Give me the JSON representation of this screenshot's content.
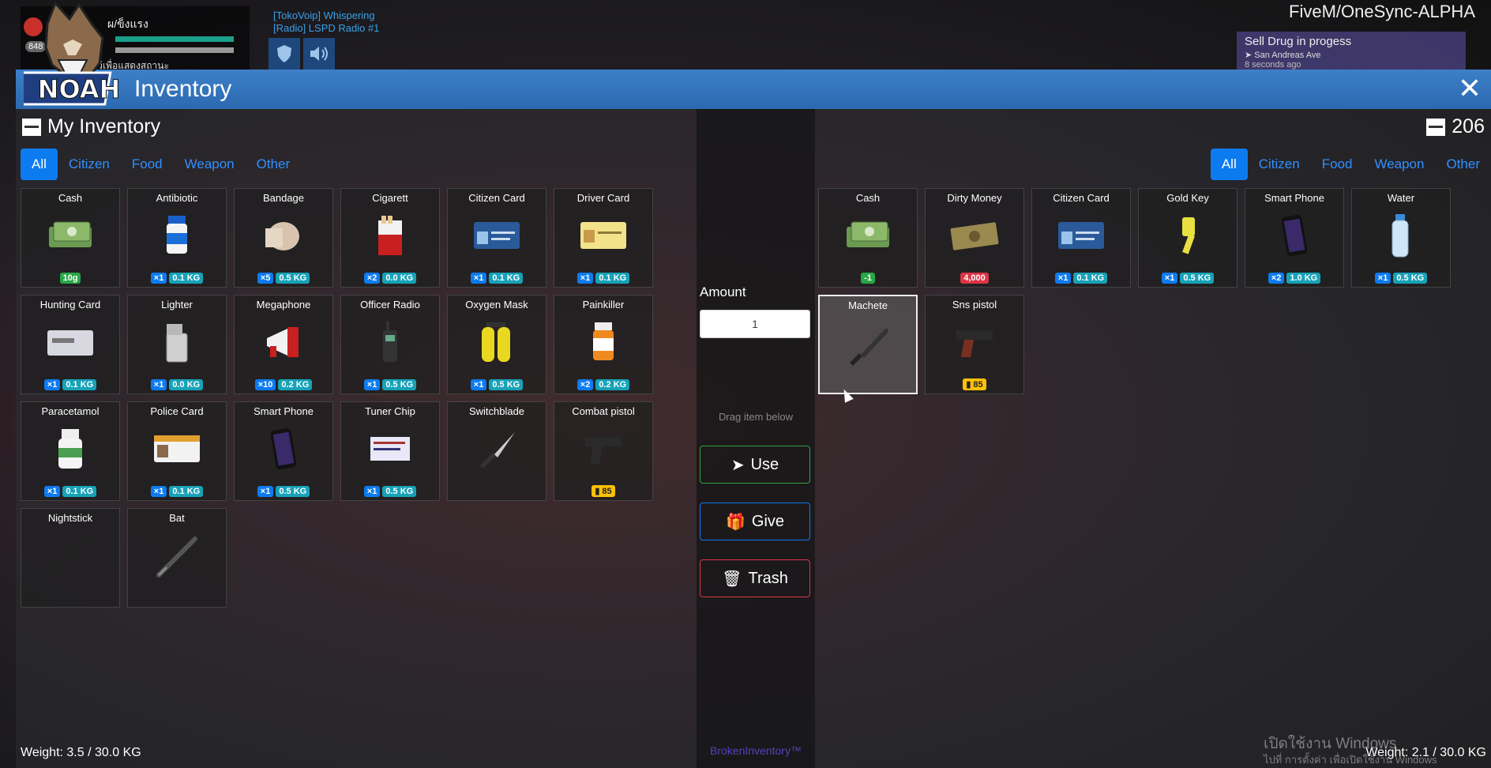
{
  "hud": {
    "status_text": "ผ/ข็งแรง",
    "sub_text": "ก  ค้างไว้เพื่อแสดงสถานะ",
    "badge": "848",
    "voip_line1": "[TokoVoip] Whispering",
    "voip_line2": "[Radio] LSPD Radio #1",
    "server_name": "FiveM/OneSync-ALPHA",
    "logo_text": "NOAH"
  },
  "notification": {
    "title": "Sell Drug in progess",
    "location": "San Andreas Ave",
    "time": "8 seconds ago"
  },
  "window": {
    "title": "Inventory",
    "close_icon": "close-icon"
  },
  "left": {
    "title": "My Inventory",
    "tabs": [
      "All",
      "Citizen",
      "Food",
      "Weapon",
      "Other"
    ],
    "active_tab": "All",
    "weight": "Weight: 3.5 / 30.0 KG",
    "items": [
      {
        "name": "Cash",
        "icon": "cash",
        "amount": "10g",
        "amount_style": "green"
      },
      {
        "name": "Antibiotic",
        "icon": "pill-bottle-blue",
        "count": "×1",
        "weight": "0.1 KG"
      },
      {
        "name": "Bandage",
        "icon": "bandage",
        "count": "×5",
        "weight": "0.5 KG"
      },
      {
        "name": "Cigarett",
        "icon": "cigarettes",
        "count": "×2",
        "weight": "0.0 KG"
      },
      {
        "name": "Citizen Card",
        "icon": "id-card-blue",
        "count": "×1",
        "weight": "0.1 KG"
      },
      {
        "name": "Driver Card",
        "icon": "id-card-yellow",
        "count": "×1",
        "weight": "0.1 KG"
      },
      {
        "name": "Hunting Card",
        "icon": "id-card-grey",
        "count": "×1",
        "weight": "0.1 KG"
      },
      {
        "name": "Lighter",
        "icon": "lighter",
        "count": "×1",
        "weight": "0.0 KG"
      },
      {
        "name": "Megaphone",
        "icon": "megaphone",
        "count": "×10",
        "weight": "0.2 KG"
      },
      {
        "name": "Officer Radio",
        "icon": "radio",
        "count": "×1",
        "weight": "0.5 KG"
      },
      {
        "name": "Oxygen Mask",
        "icon": "oxygen-tanks",
        "count": "×1",
        "weight": "0.5 KG"
      },
      {
        "name": "Painkiller",
        "icon": "pill-bottle-orange",
        "count": "×2",
        "weight": "0.2 KG"
      },
      {
        "name": "Paracetamol",
        "icon": "pill-bottle-white",
        "count": "×1",
        "weight": "0.1 KG"
      },
      {
        "name": "Police Card",
        "icon": "id-card-police",
        "count": "×1",
        "weight": "0.1 KG"
      },
      {
        "name": "Smart Phone",
        "icon": "smartphone",
        "count": "×1",
        "weight": "0.5 KG"
      },
      {
        "name": "Tuner Chip",
        "icon": "tablet",
        "count": "×1",
        "weight": "0.5 KG"
      },
      {
        "name": "Switchblade",
        "icon": "knife"
      },
      {
        "name": "Combat pistol",
        "icon": "pistol",
        "ammo": "85"
      },
      {
        "name": "Nightstick",
        "icon": "nightstick"
      },
      {
        "name": "Bat",
        "icon": "bat"
      }
    ]
  },
  "middle": {
    "amount_label": "Amount",
    "amount_value": "1",
    "drag_hint": "Drag item below",
    "use_label": "Use",
    "give_label": "Give",
    "trash_label": "Trash",
    "brand": "BrokenInventory™"
  },
  "right": {
    "count": "206",
    "tabs": [
      "All",
      "Citizen",
      "Food",
      "Weapon",
      "Other"
    ],
    "active_tab": "All",
    "weight": "Weight: 2.1 / 30.0 KG",
    "items": [
      {
        "name": "Cash",
        "icon": "cash",
        "amount": "-1",
        "amount_style": "green"
      },
      {
        "name": "Dirty Money",
        "icon": "dirty-money",
        "amount": "4,000",
        "amount_style": "red"
      },
      {
        "name": "Citizen Card",
        "icon": "id-card-blue",
        "count": "×1",
        "weight": "0.1 KG"
      },
      {
        "name": "Gold Key",
        "icon": "key",
        "count": "×1",
        "weight": "0.5 KG"
      },
      {
        "name": "Smart Phone",
        "icon": "smartphone",
        "count": "×2",
        "weight": "1.0 KG"
      },
      {
        "name": "Water",
        "icon": "water-bottle",
        "count": "×1",
        "weight": "0.5 KG"
      },
      {
        "name": "Machete",
        "icon": "machete",
        "selected": true
      },
      {
        "name": "Sns pistol",
        "icon": "pistol-brown",
        "ammo": "85"
      }
    ]
  },
  "watermark": {
    "line1": "เปิดใช้งาน Windows",
    "line2": "ไปที่ การตั้งค่า เพื่อเปิดใช้งาน Windows"
  }
}
